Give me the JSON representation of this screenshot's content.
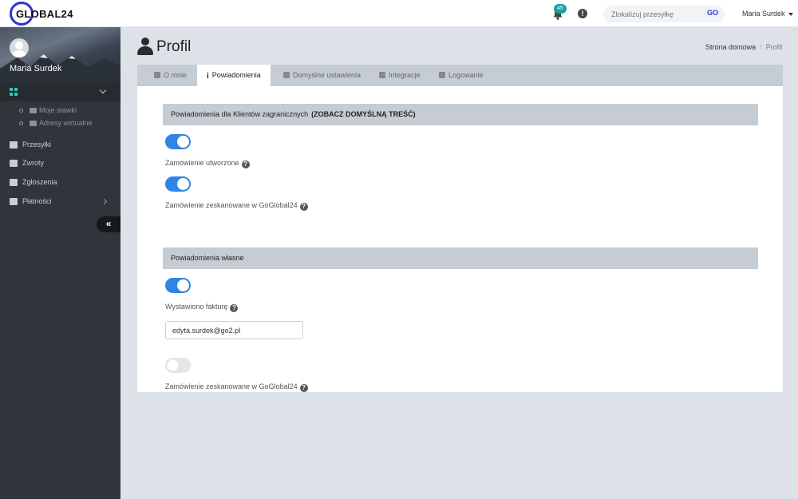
{
  "header": {
    "logo_text": "GLOBAL24",
    "notifications_count": "45",
    "alert_glyph": "!",
    "search": {
      "placeholder": "Zlokalizuj przesyłkę",
      "button_label": "GO"
    },
    "user_name": "Maria Surdek"
  },
  "sidebar": {
    "username": "Maria Surdek",
    "sub_items": [
      {
        "label": "Moje stawki",
        "icon": "camera-icon"
      },
      {
        "label": "Adresy wirtualne",
        "icon": "home-icon"
      }
    ],
    "items": [
      {
        "label": "Przesyłki",
        "icon": "package-icon"
      },
      {
        "label": "Zwroty",
        "icon": "undo-icon"
      },
      {
        "label": "Zgłoszenia",
        "icon": "warning-icon"
      },
      {
        "label": "Płatności",
        "icon": "credit-card-icon"
      }
    ],
    "collapse_glyph": "«"
  },
  "page": {
    "title": "Profil",
    "breadcrumb": {
      "home": "Strona domowa",
      "separator": "/",
      "current": "Profil"
    }
  },
  "tabs": [
    {
      "label": "O mnie",
      "icon": "home-icon"
    },
    {
      "label": "Powiadomienia",
      "icon": "info-icon",
      "glyph": "i",
      "active": true
    },
    {
      "label": "Domyślne ustawienia",
      "icon": "pencil-icon"
    },
    {
      "label": "Integracje",
      "icon": "share-icon"
    },
    {
      "label": "Logowanie",
      "icon": "user-icon"
    }
  ],
  "sections": {
    "foreign": {
      "title": "Powiadomienia dla Klientów zagranicznych",
      "link": "(ZOBACZ DOMYŚLNĄ TREŚĆ)",
      "options": [
        {
          "label": "Zamówienie utworzone",
          "enabled": true
        },
        {
          "label": "Zamówienie zeskanowane w GoGlobal24",
          "enabled": true
        }
      ]
    },
    "own": {
      "title": "Powiadomienia własne",
      "options": [
        {
          "label": "Wystawiono fakturę",
          "enabled": true,
          "email": "edyta.surdek@go2.pl"
        },
        {
          "label": "Zamówienie zeskanowane w GoGlobal24",
          "enabled": false
        }
      ]
    },
    "help_glyph": "?"
  },
  "colors": {
    "accent": "#2f84e6",
    "brand": "#2a34d6",
    "badge": "#17a2a0",
    "sidebar": "#2f353b"
  }
}
